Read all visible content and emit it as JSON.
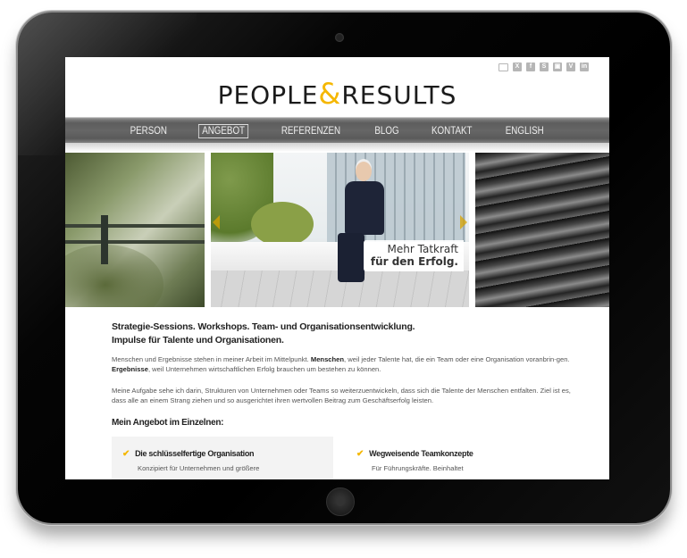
{
  "site": {
    "logo": {
      "part1": "PEOPLE",
      "amp": "&",
      "part2": "RESULTS"
    },
    "social_icons": [
      "mail-icon",
      "xing-icon",
      "facebook-icon",
      "skype-icon",
      "youtube-icon",
      "vimeo-icon",
      "linkedin-icon"
    ],
    "social_glyphs": [
      "",
      "X",
      "f",
      "S",
      "▣",
      "V",
      "in"
    ],
    "accent_color": "#f5b700"
  },
  "nav": {
    "items": [
      {
        "label": "PERSON",
        "active": false
      },
      {
        "label": "ANGEBOT",
        "active": true
      },
      {
        "label": "REFERENZEN",
        "active": false
      },
      {
        "label": "BLOG",
        "active": false
      },
      {
        "label": "KONTAKT",
        "active": false
      },
      {
        "label": "ENGLISH",
        "active": false
      }
    ]
  },
  "slider": {
    "caption_line1": "Mehr Tatkraft",
    "caption_line2": "für den Erfolg."
  },
  "content": {
    "intro_line1": "Strategie-Sessions. Workshops. Team- und Organisationsentwicklung.",
    "intro_line2": "Impulse für Talente und Organisationen.",
    "para1_a": "Menschen und Ergebnisse stehen in meiner Arbeit im Mittelpunkt. ",
    "para1_b": "Menschen",
    "para1_c": ", weil jeder Talente hat, die ein Team oder eine Organisation voranbrin-gen. ",
    "para1_d": "Ergebnisse",
    "para1_e": ", weil Unternehmen wirtschaftlichen Erfolg brauchen um bestehen zu können.",
    "para2": "Meine Aufgabe sehe ich darin,  Strukturen von Unternehmen oder Teams so weiterzuentwickeln, dass sich die Talente der Menschen entfalten. Ziel ist es, dass alle an einem Strang ziehen und so ausgerichtet ihren wertvollen Beitrag zum Geschäftserfolg leisten.",
    "subheading": "Mein Angebot im Einzelnen:",
    "offers": [
      {
        "title": "Die schlüsselfertige Organisation",
        "desc": "Konzipiert für Unternehmen und größere"
      },
      {
        "title": "Wegweisende Teamkonzepte",
        "desc": "Für Führungskräfte. Beinhaltet"
      }
    ]
  }
}
